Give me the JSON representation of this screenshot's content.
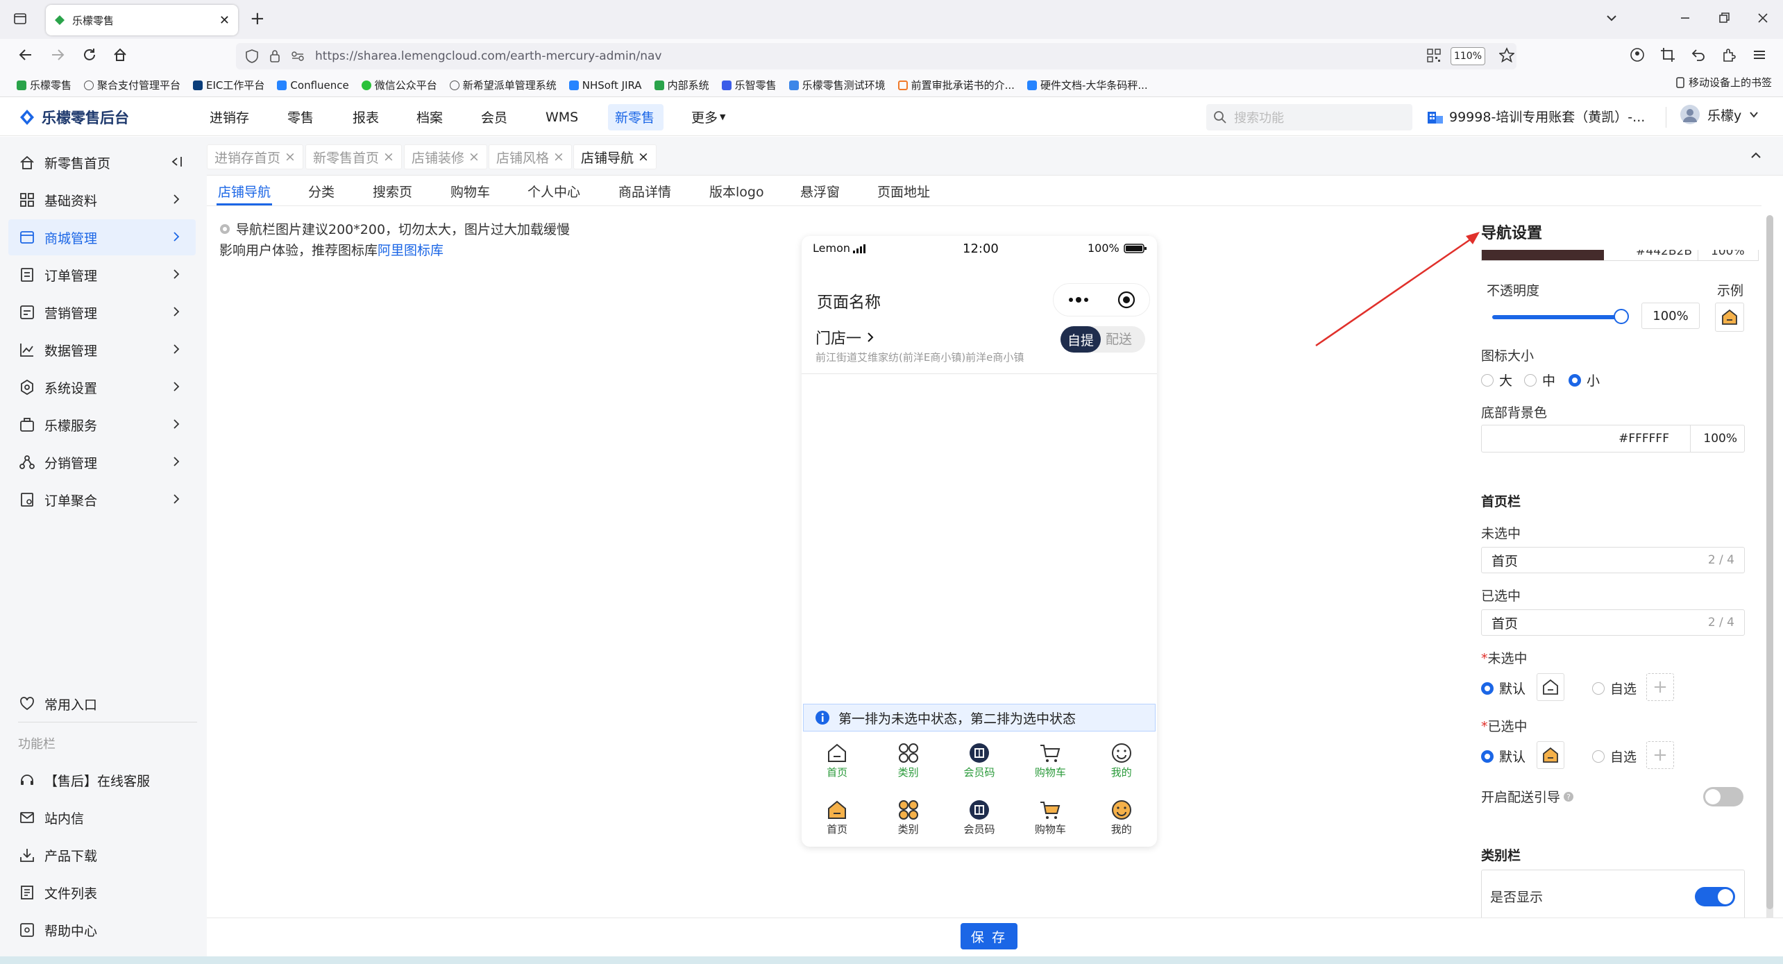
{
  "browser": {
    "tab_title": "乐檬零售",
    "url": "https://sharea.lemengcloud.com/earth-mercury-admin/nav",
    "zoom": "110%",
    "bookmarks": [
      "乐檬零售",
      "聚合支付管理平台",
      "EIC工作平台",
      "Confluence",
      "微信公众平台",
      "新希望派单管理系统",
      "NHSoft JIRA",
      "内部系统",
      "乐智零售",
      "乐檬零售测试环境",
      "前置审批承诺书的介...",
      "硬件文档-大华条码秤..."
    ],
    "mobile_bookmarks": "移动设备上的书签"
  },
  "app": {
    "brand": "乐檬零售后台",
    "topnav": [
      "进销存",
      "零售",
      "报表",
      "档案",
      "会员",
      "WMS",
      "新零售",
      "更多"
    ],
    "search_placeholder": "搜索功能",
    "account": "99998-培训专用账套（黄凯）-...",
    "user": "乐檬y"
  },
  "sidebar": {
    "items": [
      {
        "label": "新零售首页"
      },
      {
        "label": "基础资料"
      },
      {
        "label": "商城管理"
      },
      {
        "label": "订单管理"
      },
      {
        "label": "营销管理"
      },
      {
        "label": "数据管理"
      },
      {
        "label": "系统设置"
      },
      {
        "label": "乐檬服务"
      },
      {
        "label": "分销管理"
      },
      {
        "label": "订单聚合"
      }
    ],
    "common_entry": "常用入口",
    "section_title": "功能栏",
    "func_items": [
      "【售后】在线客服",
      "站内信",
      "产品下载",
      "文件列表",
      "帮助中心"
    ]
  },
  "page_tabs": [
    "进销存首页",
    "新零售首页",
    "店铺装修",
    "店铺风格",
    "店铺导航"
  ],
  "sub_tabs": [
    "店铺导航",
    "分类",
    "搜索页",
    "购物车",
    "个人中心",
    "商品详情",
    "版本logo",
    "悬浮窗",
    "页面地址"
  ],
  "hint": {
    "line1": "导航栏图片建议200*200，切勿太大，图片过大加载缓慢",
    "line2_prefix": "影响用户体验，推荐图标库",
    "line2_link": "阿里图标库"
  },
  "phone": {
    "carrier": "Lemon",
    "time": "12:00",
    "battery": "100%",
    "page_name": "页面名称",
    "store": "门店一",
    "store_address": "前江街道艾维家纺(前洋E商小镇)前洋e商小镇",
    "pick_self": "自提",
    "pick_delivery": "配送",
    "info": "第一排为未选中状态，第二排为选中状态",
    "nav_labels": [
      "首页",
      "类别",
      "会员码",
      "购物车",
      "我的"
    ]
  },
  "panel": {
    "title": "导航设置",
    "color_hex_partial": "#442B2B",
    "color_pct_partial": "100%",
    "opacity_label": "不透明度",
    "opacity_value": "100%",
    "opacity_fraction": 1.0,
    "example_label": "示例",
    "icon_size_label": "图标大小",
    "icon_sizes": [
      "大",
      "中",
      "小"
    ],
    "bottom_bg_label": "底部背景色",
    "bottom_bg_hex": "#FFFFFF",
    "bottom_bg_pct": "100%",
    "home_section": "首页栏",
    "unselected_label": "未选中",
    "unselected_value": "首页",
    "unselected_count": "2 / 4",
    "selected_label": "已选中",
    "selected_value": "首页",
    "selected_count": "2 / 4",
    "unselected_icon_label": "未选中",
    "selected_icon_label": "已选中",
    "default_option": "默认",
    "custom_option": "自选",
    "delivery_guide_label": "开启配送引导",
    "category_section": "类别栏",
    "show_label": "是否显示"
  },
  "footer": {
    "save": "保 存"
  },
  "colors": {
    "accent": "#1b66e6",
    "nav_dark": "#1f2d4d",
    "icon_orange": "#f5b14a"
  }
}
